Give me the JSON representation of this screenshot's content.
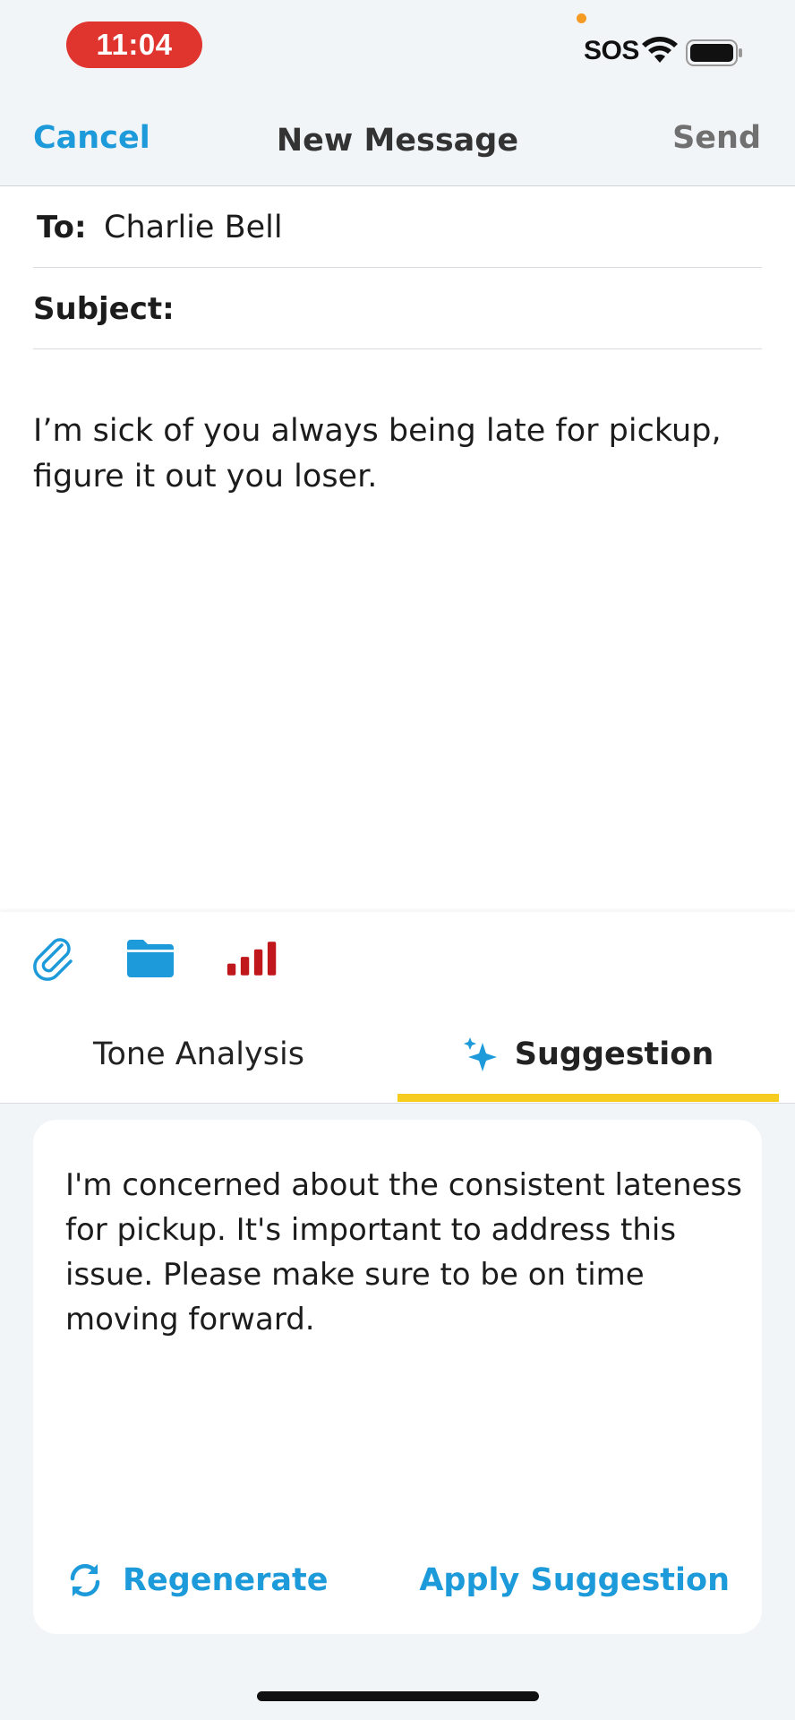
{
  "status_bar": {
    "time": "11:04",
    "sos": "SOS",
    "icons": [
      "orange-dot",
      "wifi-icon",
      "battery-icon"
    ]
  },
  "navbar": {
    "cancel": "Cancel",
    "title": "New Message",
    "send": "Send"
  },
  "compose": {
    "to_label": "To:",
    "to_value": "Charlie Bell",
    "subject_label": "Subject:",
    "subject_value": "",
    "body": "I’m sick of you always being late for pickup, figure it out you loser."
  },
  "toolbar": {
    "icons": [
      "paperclip-icon",
      "folder-icon",
      "signal-bars-icon"
    ]
  },
  "tabs": {
    "tone_analysis": "Tone Analysis",
    "suggestion": "Suggestion",
    "active": "Suggestion"
  },
  "suggestion_card": {
    "text": "I'm concerned about the consistent lateness for pickup. It's important to address this issue. Please make sure to be on time moving forward.",
    "regenerate": "Regenerate",
    "apply": "Apply Suggestion"
  },
  "colors": {
    "accent": "#1d9ad9",
    "time_pill": "#e0342e",
    "tab_underline": "#f6cd1e",
    "signal_bars": "#c0171c",
    "background": "#f2f5f8"
  }
}
